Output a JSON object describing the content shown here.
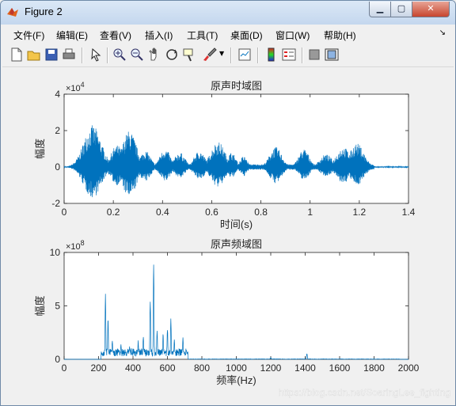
{
  "window": {
    "title": "Figure 2"
  },
  "menu": [
    "文件(F)",
    "编辑(E)",
    "查看(V)",
    "插入(I)",
    "工具(T)",
    "桌面(D)",
    "窗口(W)",
    "帮助(H)"
  ],
  "toolbar_icons": [
    "new-figure-icon",
    "open-file-icon",
    "save-icon",
    "print-icon",
    "pointer-icon",
    "zoom-in-icon",
    "zoom-out-icon",
    "pan-icon",
    "rotate-3d-icon",
    "data-cursor-icon",
    "brush-icon",
    "link-plot-icon",
    "colorbar-icon",
    "legend-icon",
    "hide-plot-tools-icon",
    "show-plot-tools-icon"
  ],
  "watermark": "https://blog.csdn.net/SoaringLee_fighting",
  "chart_data": [
    {
      "type": "line",
      "title": "原声时域图",
      "xlabel": "时间(s)",
      "ylabel": "幅度",
      "exponent": "4",
      "xlim": [
        0,
        1.4
      ],
      "ylim": [
        -20000,
        40000
      ],
      "xticks": [
        "0",
        "0.2",
        "0.4",
        "0.6",
        "0.8",
        "1",
        "1.2",
        "1.4"
      ],
      "yticks": [
        "-2",
        "0",
        "2",
        "4"
      ],
      "color": "#0072bd",
      "bursts": [
        {
          "t": 0.115,
          "w": 0.05,
          "pos": 23000,
          "neg": -17000
        },
        {
          "t": 0.215,
          "w": 0.035,
          "pos": 12000,
          "neg": -10000
        },
        {
          "t": 0.265,
          "w": 0.04,
          "pos": 20000,
          "neg": -17000
        },
        {
          "t": 0.33,
          "w": 0.03,
          "pos": 9000,
          "neg": -8000
        },
        {
          "t": 0.41,
          "w": 0.03,
          "pos": 10000,
          "neg": -8000
        },
        {
          "t": 0.47,
          "w": 0.03,
          "pos": 8000,
          "neg": -6000
        },
        {
          "t": 0.55,
          "w": 0.03,
          "pos": 9000,
          "neg": -7000
        },
        {
          "t": 0.625,
          "w": 0.04,
          "pos": 14000,
          "neg": -11000
        },
        {
          "t": 0.68,
          "w": 0.025,
          "pos": 8000,
          "neg": -6000
        },
        {
          "t": 0.73,
          "w": 0.02,
          "pos": 6000,
          "neg": -5000
        },
        {
          "t": 0.86,
          "w": 0.035,
          "pos": 11000,
          "neg": -9000
        },
        {
          "t": 0.975,
          "w": 0.03,
          "pos": 10000,
          "neg": -7000
        },
        {
          "t": 1.065,
          "w": 0.035,
          "pos": 7000,
          "neg": -5000
        },
        {
          "t": 1.135,
          "w": 0.04,
          "pos": 11000,
          "neg": -9000
        },
        {
          "t": 1.19,
          "w": 0.04,
          "pos": 13000,
          "neg": -10000
        }
      ],
      "active_range": [
        0.09,
        1.26
      ]
    },
    {
      "type": "line",
      "title": "原声频域图",
      "xlabel": "频率(Hz)",
      "ylabel": "幅度",
      "exponent": "8",
      "xlim": [
        0,
        2000
      ],
      "ylim": [
        0,
        1000000000
      ],
      "xticks": [
        "0",
        "200",
        "400",
        "600",
        "800",
        "1000",
        "1200",
        "1400",
        "1600",
        "1800",
        "2000"
      ],
      "yticks": [
        "0",
        "5",
        "10"
      ],
      "color": "#0072bd",
      "peaks": [
        {
          "f": 240,
          "v": 670000000
        },
        {
          "f": 255,
          "v": 420000000
        },
        {
          "f": 280,
          "v": 200000000
        },
        {
          "f": 330,
          "v": 150000000
        },
        {
          "f": 380,
          "v": 120000000
        },
        {
          "f": 430,
          "v": 180000000
        },
        {
          "f": 460,
          "v": 220000000
        },
        {
          "f": 500,
          "v": 580000000
        },
        {
          "f": 520,
          "v": 970000000
        },
        {
          "f": 540,
          "v": 300000000
        },
        {
          "f": 575,
          "v": 250000000
        },
        {
          "f": 600,
          "v": 320000000
        },
        {
          "f": 620,
          "v": 390000000
        },
        {
          "f": 640,
          "v": 200000000
        },
        {
          "f": 690,
          "v": 230000000
        },
        {
          "f": 1200,
          "v": 20000000
        },
        {
          "f": 1410,
          "v": 60000000
        }
      ]
    }
  ]
}
